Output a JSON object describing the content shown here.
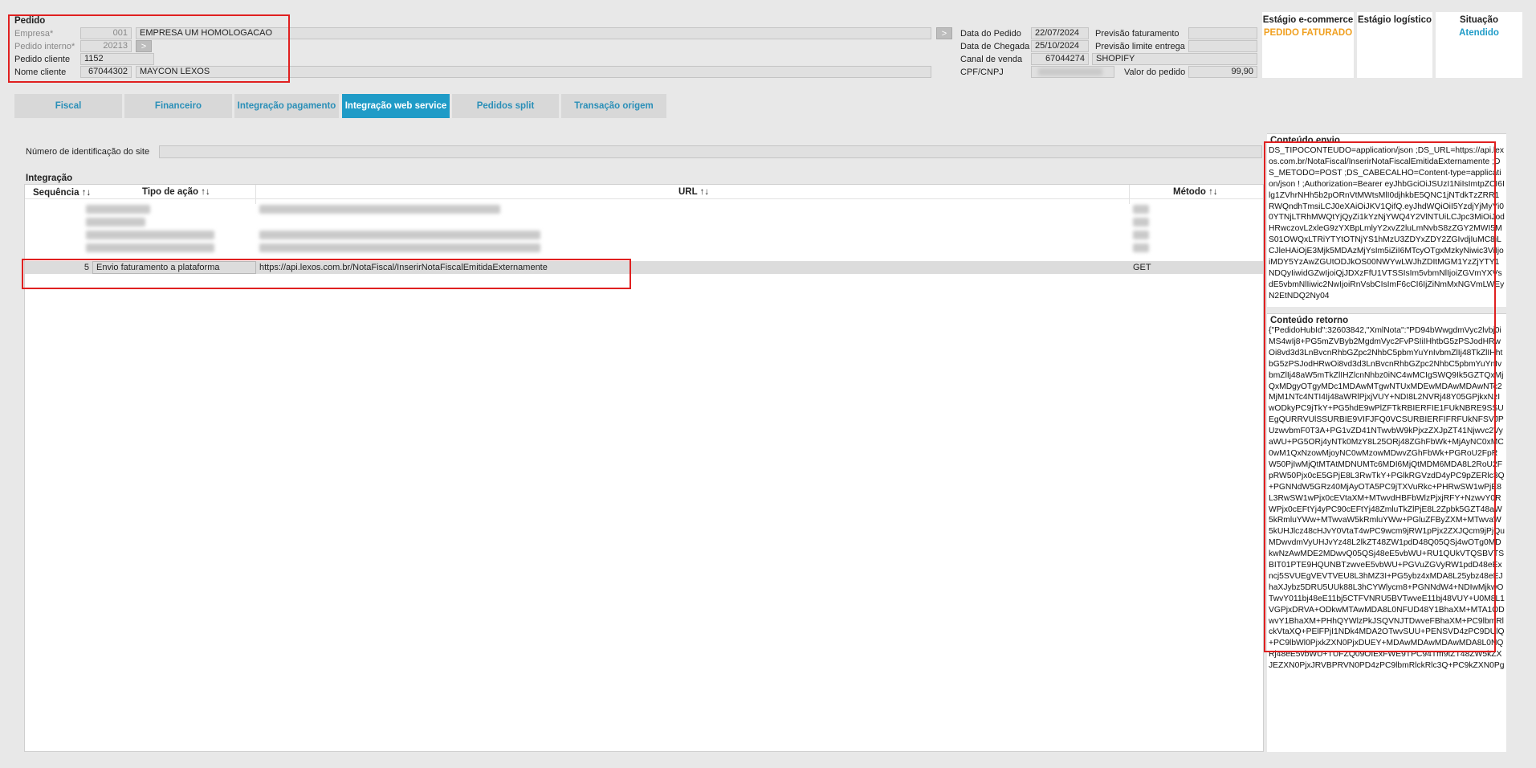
{
  "pedido": {
    "section_title": "Pedido",
    "empresa_label": "Empresa*",
    "empresa_code": "001",
    "empresa_name": "EMPRESA UM HOMOLOGACAO",
    "pedido_interno_label": "Pedido interno*",
    "pedido_interno_value": "20213",
    "pedido_cliente_label": "Pedido cliente",
    "pedido_cliente_value": "1152",
    "nome_cliente_label": "Nome cliente",
    "nome_cliente_code": "67044302",
    "nome_cliente_name": "MAYCON LEXOS"
  },
  "datas": {
    "data_pedido_label": "Data do Pedido",
    "data_pedido_value": "22/07/2024",
    "data_chegada_label": "Data de Chegada",
    "data_chegada_value": "25/10/2024",
    "canal_label": "Canal de venda",
    "canal_code": "67044274",
    "canal_name": "SHOPIFY",
    "cpf_label": "CPF/CNPJ",
    "previsao_fat_label": "Previsão faturamento",
    "previsao_lim_label": "Previsão limite entrega",
    "valor_label": "Valor do pedido",
    "valor_value": "99,90"
  },
  "stages": {
    "ecommerce_title": "Estágio e-commerce",
    "ecommerce_value": "PEDIDO FATURADO",
    "logistico_title": "Estágio logístico",
    "logistico_value": "",
    "situacao_title": "Situação",
    "situacao_value": "Atendido",
    "colors": {
      "ecommerce": "#f0a020",
      "situacao": "#1f9bc7"
    }
  },
  "tabs": [
    {
      "label": "Fiscal"
    },
    {
      "label": "Financeiro"
    },
    {
      "label": "Integração pagamento"
    },
    {
      "label": "Integração web service"
    },
    {
      "label": "Pedidos split"
    },
    {
      "label": "Transação origem"
    }
  ],
  "site_id": {
    "label": "Número de identificação do site",
    "value": ""
  },
  "integracao": {
    "title": "Integração",
    "columns": [
      {
        "label": "Sequência ↑↓"
      },
      {
        "label": "Tipo de ação ↑↓"
      },
      {
        "label": "URL ↑↓"
      },
      {
        "label": "Método ↑↓"
      }
    ],
    "selected_row": {
      "seq": "5",
      "tipo": "Envio faturamento a plataforma",
      "url": "https://api.lexos.com.br/NotaFiscal/InserirNotaFiscalEmitidaExternamente",
      "metodo": "GET"
    }
  },
  "envio": {
    "title": "Conteúdo envio",
    "text": "DS_TIPOCONTEUDO=application/json ;DS_URL=https://api.lexos.com.br/NotaFiscal/InserirNotaFiscalEmitidaExternamente ;DS_METODO=POST ;DS_CABECALHO=Content-type=application/json ! ;Authorization=Bearer eyJhbGciOiJSUzI1NiIsImtpZCI6Ilg1ZVhrNHh5b2pORnVtMWtsMlI0djhkbE5QNC1jNTdkTzZRR1RWQndhTmsiLCJ0eXAiOiJKV1QifQ.eyJhdWQiOiI5YzdjYjMyYi00YTNjLTRhMWQtYjQyZi1kYzNjYWQ4Y2VlNTUiLCJpc3MiOiJodHRwczovL2xleG9zYXBpLmlyY2xvZ2luLmNvbS8zZGY2MWI5MS01OWQxLTRiYTYtOTNjYS1hMzU3ZDYxZDY2ZGIvdjIuMC8iLCJleHAiOjE3Mjk5MDAzMjYsIm5iZiI6MTcyOTgxMzkyNiwic3ViIjoiMDY5YzAwZGUtODJkOS00NWYwLWJhZDItMGM1YzZjYTY1NDQyIiwidGZwIjoiQjJDXzFfU1VTSSIsIm5vbmNlIjoiZGVmYXVsdE5vbmNlIiwic2NwIjoiRnVsbCIsImF6cCI6IjZiNmMxNGVmLWEyN2EtNDQ2Ny04"
  },
  "retorno": {
    "title": "Conteúdo retorno",
    "text": "{\"PedidoHubId\":32603842,\"XmlNota\":\"PD94bWwgdmVyc2lvbj0iMS4wIj8+PG5mZVByb2MgdmVyc2FvPSIiIHhtbG5zPSJodHRwOi8vd3d3LnBvcnRhbGZpc2NhbC5pbmYuYnIvbmZlIj48TkZlIHhtbG5zPSJodHRwOi8vd3d3LnBvcnRhbGZpc2NhbC5pbmYuYnIvbmZlIj48aW5mTkZlIHZlcnNhbz0iNC4wMCIgSWQ9Ik5GZTQxMjQxMDgyOTgyMDc1MDAwMTgwNTUxMDEwMDAwMDAwNTc2MjM1NTc4NTI4Ij48aWRlPjxjVUY+NDI8L2NVRj48Y05GPjkxNzIwODkyPC9jTkY+PG5hdE9wPlZFTkRBIERFIE1FUkNBRE9SSUEgQURRVUlSSURBIE9VIFJFQ0VCSURBIERFIFRFUkNFSVJPUzwvbmF0T3A+PG1vZD41NTwvbW9kPjxzZXJpZT41Njwvc2VyaWU+PG5ORj4yNTk0MzY8L25ORj48ZGhFbWk+MjAyNC0xMC0wM1QxNzowMjoyNC0wMzowMDwvZGhFbWk+PGRoU2FpRW50PjIwMjQtMTAtMDNUMTc6MDI6MjQtMDM6MDA8L2RoU2FpRW50Pjx0cE5GPjE8L3RwTkY+PGlkRGVzdD4yPC9pZERlc3Q+PGNNdW5GRz40MjAyOTA5PC9jTXVuRkc+PHRwSW1wPjE8L3RwSW1wPjx0cEVtaXM+MTwvdHBFbWlzPjxjRFY+NzwvY0RWPjx0cEFtYj4yPC90cEFtYj48ZmluTkZlPjE8L2Zpbk5GZT48aW5kRmluYWw+MTwvaW5kRmluYWw+PGluZFByZXM+MTwvaW5kUHJlcz48cHJvY0VtaT4wPC9wcm9jRW1pPjx2ZXJQcm9jPjQuMDwvdmVyUHJvYz48L2lkZT48ZW1pdD48Q05QSj4wOTg0MDkwNzAwMDE2MDwvQ05QSj48eE5vbWU+RU1QUkVTQSBVTSBIT01PTE9HQUNBTzwveE5vbWU+PGVuZGVyRW1pdD48eExncj5SVUEgVEVTVEU8L3hMZ3I+PG5ybz4xMDA8L25ybz48eEJhaXJybz5DRU5UUk88L3hCYWlycm8+PGNNdW4+NDIwMjkwOTwvY011bj48eE11bj5CTFVNRU5BVTwveE11bj48VUY+U0M8L1VGPjxDRVA+ODkwMTAwMDA8L0NFUD48Y1BhaXM+MTA1ODwvY1BhaXM+PHhQYWlzPkJSQVNJTDwveFBhaXM+PC9lbmRlckVtaXQ+PElFPjI1NDk4MDA2OTwvSUU+PENSVD4zPC9DUlQ+PC9lbWl0PjxkZXN0PjxDUEY+MDAwMDAwMDAwMDA8L0NQRj48eE5vbWU+TUFZQ09OIExFWE9TPC94Tm9tZT48ZW5kZXJEZXN0PjxJRVBPRVN0PD4zPC9lbmRlckRlc3Q+PC9kZXN0Pg"
  }
}
